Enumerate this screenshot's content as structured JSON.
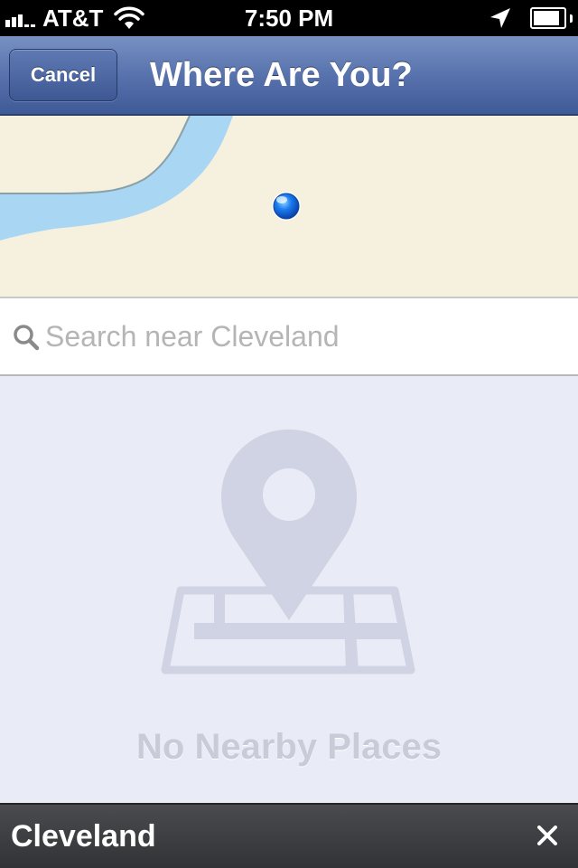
{
  "status_bar": {
    "carrier": "AT&T",
    "time": "7:50 PM",
    "battery_level": 0.9,
    "signal_bars": 3,
    "icons": [
      "signal-icon",
      "wifi-icon",
      "location-arrow-icon",
      "battery-icon"
    ]
  },
  "nav": {
    "cancel_label": "Cancel",
    "title": "Where Are You?"
  },
  "map": {
    "icons": [
      "current-location-dot-icon"
    ]
  },
  "search": {
    "placeholder": "Search near Cleveland",
    "value": "",
    "icon": "search-icon"
  },
  "empty_state": {
    "message": "No Nearby Places",
    "icon": "map-pin-icon"
  },
  "bottom_bar": {
    "location": "Cleveland",
    "close_icon": "close-icon"
  },
  "colors": {
    "nav_bar": "#5872ad",
    "map_land": "#f6f0df",
    "map_water": "#a8d6f3",
    "empty_background": "#e9ecf6",
    "empty_illustration": "#d0d3e3",
    "bottom_bar": "#3c3d40"
  }
}
